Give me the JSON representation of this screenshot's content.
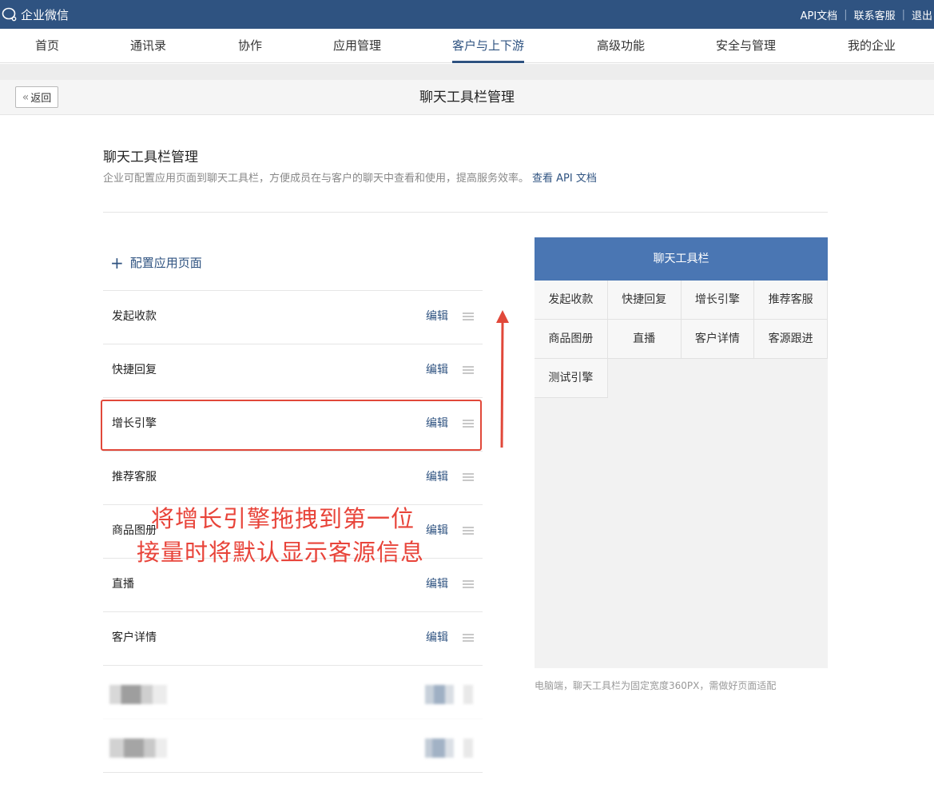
{
  "topbar": {
    "brand": "企业微信",
    "links": [
      "API文档",
      "联系客服",
      "退出"
    ]
  },
  "nav": {
    "items": [
      "首页",
      "通讯录",
      "协作",
      "应用管理",
      "客户与上下游",
      "高级功能",
      "安全与管理",
      "我的企业"
    ],
    "active": "客户与上下游"
  },
  "page_header": {
    "back_label": "返回",
    "title": "聊天工具栏管理"
  },
  "section": {
    "title": "聊天工具栏管理",
    "description": "企业可配置应用页面到聊天工具栏，方便成员在与客户的聊天中查看和使用，提高服务效率。",
    "doc_link": "查看 API 文档"
  },
  "config_list": {
    "add_label": "配置应用页面",
    "edit_label": "编辑",
    "items": [
      "发起收款",
      "快捷回复",
      "增长引擎",
      "推荐客服",
      "商品图册",
      "直播",
      "客户详情"
    ]
  },
  "annotation": {
    "line1": "将增长引擎拖拽到第一位",
    "line2": "接量时将默认显示客源信息",
    "color": "#e8443a"
  },
  "preview": {
    "title": "聊天工具栏",
    "items": [
      "发起收款",
      "快捷回复",
      "增长引擎",
      "推荐客服",
      "商品图册",
      "直播",
      "客户详情",
      "客源跟进",
      "测试引擎"
    ],
    "note": "电脑端，聊天工具栏为固定宽度360PX，需做好页面适配"
  },
  "colors": {
    "brand": "#2f5381",
    "accent": "#4a76b3",
    "annotation": "#e8443a"
  }
}
